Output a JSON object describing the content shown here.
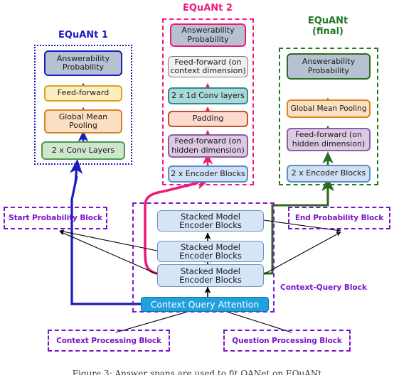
{
  "figure": {
    "caption": "Figure 3: Answer spans are used to fit QANet on EQuANt"
  },
  "colors": {
    "equant1_accent": "#1b1bbf",
    "equant2_accent": "#f0197c",
    "equant_final_accent": "#1f7a1f",
    "purple": "#7b14c9",
    "cqa_fill": "#20a0dd",
    "cqa_border": "#1273a8",
    "answerability_fill": "#b6c2d2",
    "feedforward_fill": "#fdeec2",
    "feedforward_border": "#d9a320",
    "pooling_fill": "#fbdfc2",
    "pooling_border": "#d9851f",
    "conv_fill": "#cfe6cd",
    "conv_border": "#4a9a4a",
    "ff_context_fill": "#f0f0f0",
    "ff_context_border": "#808080",
    "conv1d_fill": "#aad9d9",
    "conv1d_border": "#2f8c8c",
    "padding_fill": "#fadbcd",
    "padding_border": "#c0522d",
    "ff_hidden_fill": "#dcc9e3",
    "ff_hidden_border": "#8a5fa8",
    "encoder_fill": "#cfe0f4",
    "encoder_border": "#5a8ec4",
    "stacked_fill": "#d6e4f7",
    "stacked_border": "#6b94c4"
  },
  "columns": {
    "equant1": {
      "title": "EQuANt 1",
      "nodes": [
        {
          "label": "Answerability\nProbability"
        },
        {
          "label": "Feed-forward"
        },
        {
          "label": "Global Mean\nPooling"
        },
        {
          "label": "2 x Conv Layers"
        }
      ]
    },
    "equant2": {
      "title": "EQuANt 2",
      "nodes": [
        {
          "label": "Answerability\nProbability"
        },
        {
          "label": "Feed-forward (on\ncontext dimension)"
        },
        {
          "label": "2 x 1d Conv layers"
        },
        {
          "label": "Padding"
        },
        {
          "label": "Feed-forward (on\nhidden dimension)"
        },
        {
          "label": "2 x Encoder Blocks"
        }
      ]
    },
    "equant_final": {
      "title": "EQuANt\n(final)",
      "title_line1": "EQuANt",
      "title_line2": "(final)",
      "nodes": [
        {
          "label": "Answerability\nProbability"
        },
        {
          "label": "Global Mean Pooling"
        },
        {
          "label": "Feed-forward (on\nhidden dimension)"
        },
        {
          "label": "2 x Encoder Blocks"
        }
      ]
    }
  },
  "qanet": {
    "stacked_blocks": [
      {
        "label": "Stacked Model\nEncoder Blocks"
      },
      {
        "label": "Stacked Model\nEncoder Blocks"
      },
      {
        "label": "Stacked Model\nEncoder Blocks"
      }
    ],
    "attention": {
      "label": "Context Query Attention"
    }
  },
  "blocks": {
    "start_probability": "Start Probability Block",
    "end_probability": "End Probability Block",
    "context_query": "Context-Query Block",
    "context_processing": "Context Processing Block",
    "question_processing": "Question Processing Block"
  }
}
